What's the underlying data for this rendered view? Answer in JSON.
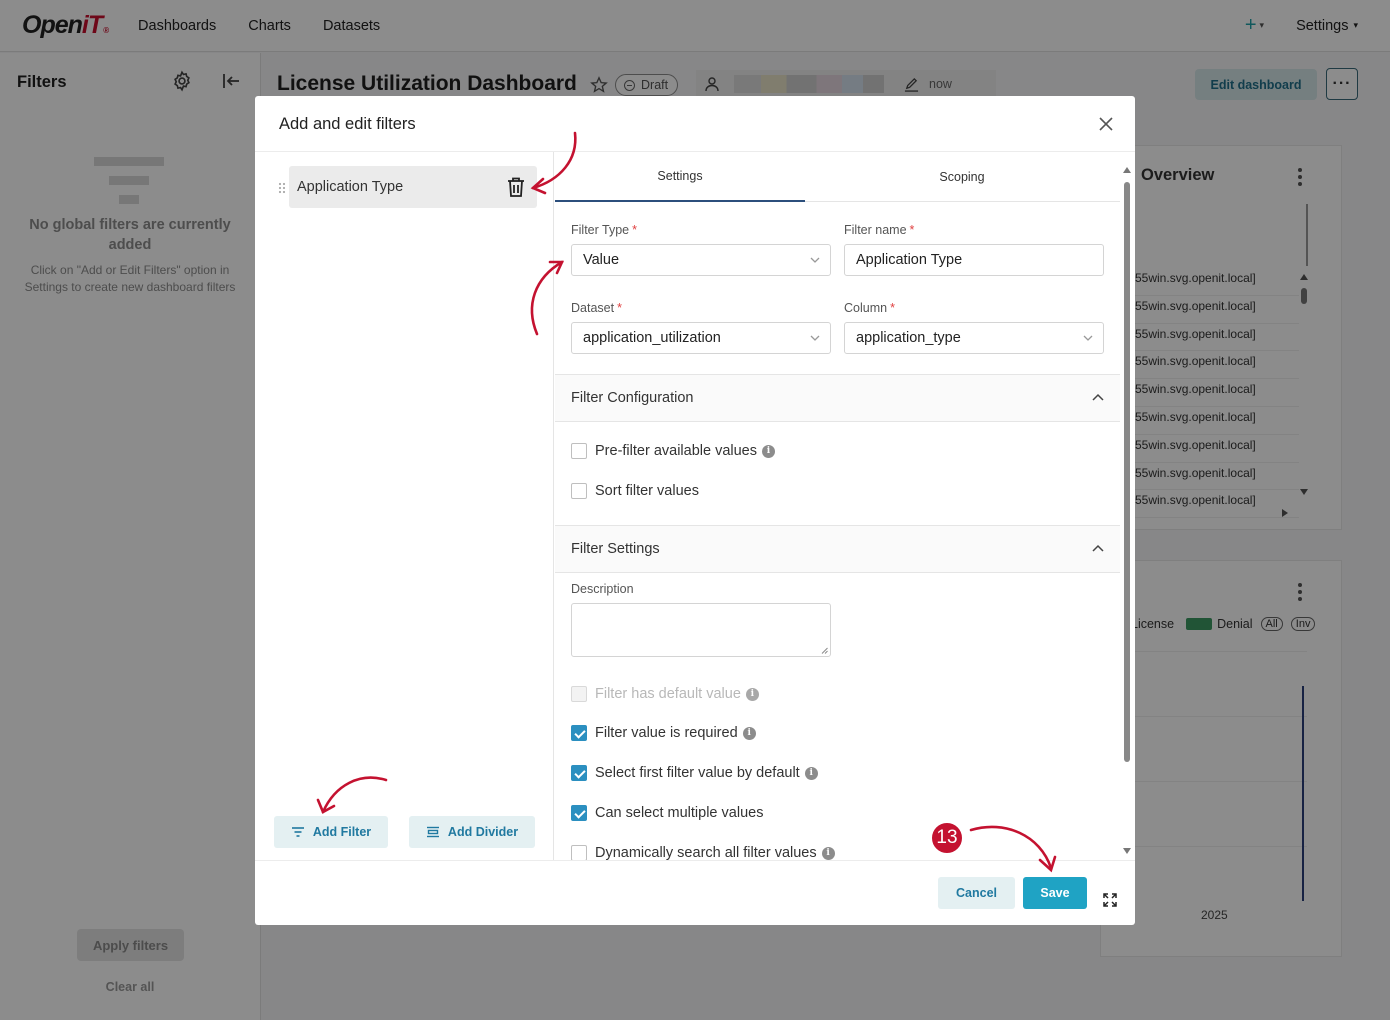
{
  "navbar": {
    "logo_main": "Open",
    "logo_accent": "iT",
    "logo_tm": "®",
    "links": [
      "Dashboards",
      "Charts",
      "Datasets"
    ],
    "plus_label": "+",
    "settings_label": "Settings"
  },
  "filter_panel": {
    "title": "Filters",
    "empty_title": "No global filters are currently added",
    "empty_desc": "Click on \"Add or Edit Filters\" option in Settings to create new dashboard filters",
    "apply_label": "Apply filters",
    "clear_label": "Clear all"
  },
  "dashboard": {
    "title": "License Utilization Dashboard",
    "status": "Draft",
    "modified": "now",
    "edit_label": "Edit dashboard",
    "more_label": "···",
    "card1_title": "Overview",
    "hosts": [
      "55win.svg.openit.local]",
      "55win.svg.openit.local]",
      "55win.svg.openit.local]",
      "55win.svg.openit.local]",
      "55win.svg.openit.local]",
      "55win.svg.openit.local]",
      "55win.svg.openit.local]",
      "55win.svg.openit.local]",
      "55win.svg.openit.local]"
    ],
    "legend_license": "License",
    "legend_denial": "Denial",
    "legend_all": "All",
    "legend_inv": "Inv",
    "year": "2025"
  },
  "modal": {
    "title": "Add and edit filters",
    "filter_item": "Application Type",
    "add_filter_label": "Add Filter",
    "add_divider_label": "Add Divider",
    "tabs": [
      "Settings",
      "Scoping"
    ],
    "filter_type_label": "Filter Type",
    "filter_type_value": "Value",
    "filter_name_label": "Filter name",
    "filter_name_value": "Application Type",
    "dataset_label": "Dataset",
    "dataset_value": "application_utilization",
    "column_label": "Column",
    "column_value": "application_type",
    "config_section": "Filter Configuration",
    "prefilter_label": "Pre-filter available values",
    "sort_label": "Sort filter values",
    "settings_section": "Filter Settings",
    "description_label": "Description",
    "has_default_label": "Filter has default value",
    "required_label": "Filter value is required",
    "select_first_label": "Select first filter value by default",
    "multiple_label": "Can select multiple values",
    "dynamic_search_label": "Dynamically search all filter values",
    "cancel_label": "Cancel",
    "save_label": "Save"
  },
  "annotation": {
    "step": "13"
  },
  "colors": {
    "accent": "#1fa3c4",
    "brand_red": "#c8102e",
    "arrow_red": "#c41230",
    "check_blue": "#2b8fc0"
  }
}
